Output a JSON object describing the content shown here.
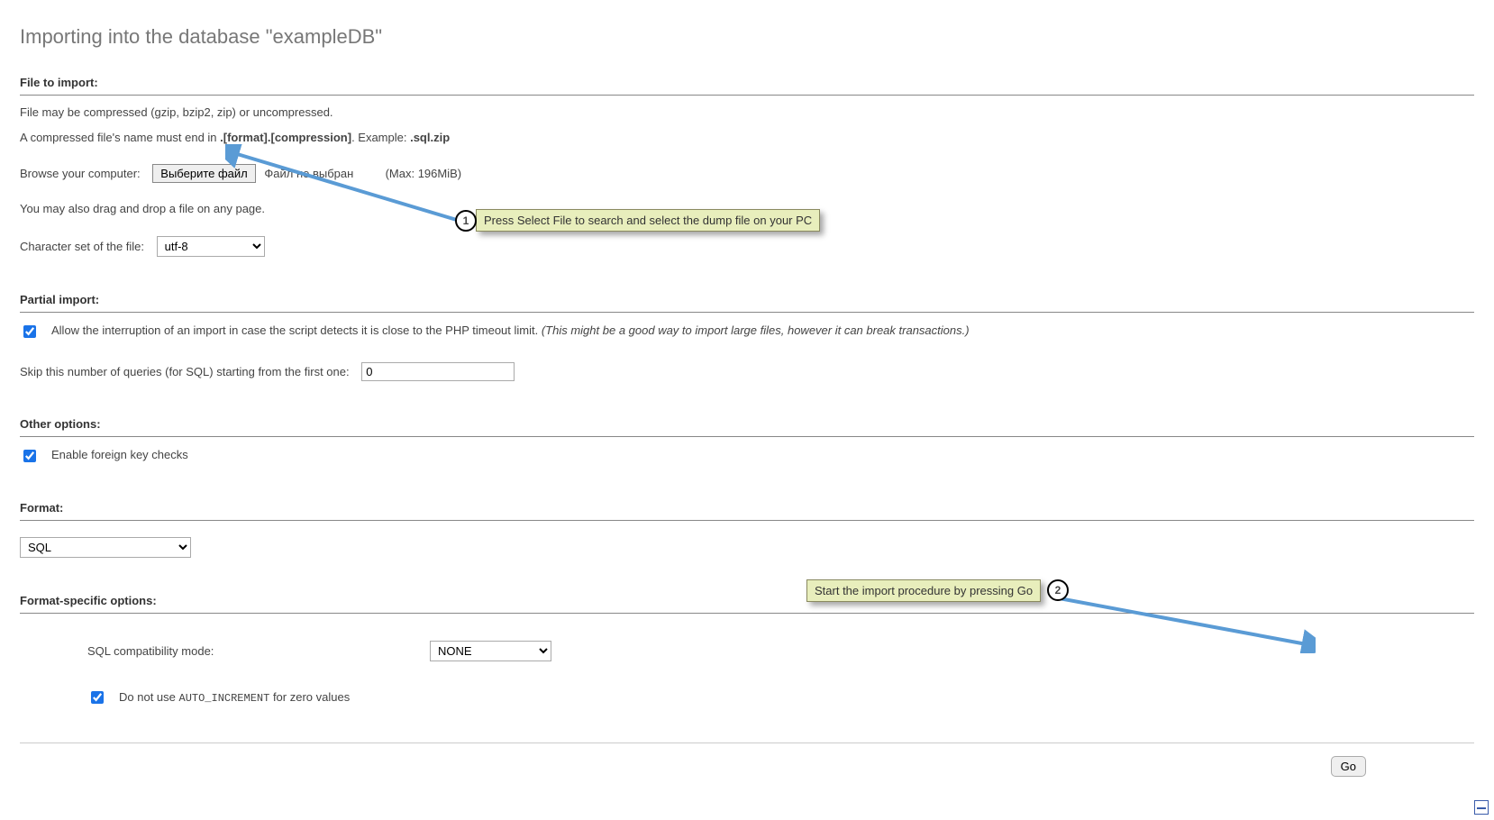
{
  "page_title": "Importing into the database \"exampleDB\"",
  "file_to_import": {
    "heading": "File to import:",
    "compressed_note": "File may be compressed (gzip, bzip2, zip) or uncompressed.",
    "name_note_prefix": "A compressed file's name must end in ",
    "name_note_pattern": ".[format].[compression]",
    "name_note_example_label": ". Example: ",
    "name_note_example": ".sql.zip",
    "browse_label": "Browse your computer:",
    "browse_button": "Выберите файл",
    "no_file_selected": "Файл не выбран",
    "max_label": "(Max: 196MiB)",
    "drag_note": "You may also drag and drop a file on any page.",
    "charset_label": "Character set of the file:",
    "charset_value": "utf-8"
  },
  "partial_import": {
    "heading": "Partial import:",
    "allow_interrupt_checked": true,
    "allow_interrupt_text": "Allow the interruption of an import in case the script detects it is close to the PHP timeout limit. ",
    "allow_interrupt_note": "(This might be a good way to import large files, however it can break transactions.)",
    "skip_label": "Skip this number of queries (for SQL) starting from the first one:",
    "skip_value": "0"
  },
  "other_options": {
    "heading": "Other options:",
    "fk_checked": true,
    "fk_label": "Enable foreign key checks"
  },
  "format": {
    "heading": "Format:",
    "value": "SQL"
  },
  "format_specific": {
    "heading": "Format-specific options:",
    "compat_label": "SQL compatibility mode:",
    "compat_value": "NONE",
    "no_ai_checked": true,
    "no_ai_prefix": "Do not use ",
    "no_ai_code": "AUTO_INCREMENT",
    "no_ai_suffix": " for zero values"
  },
  "go_button": "Go",
  "annotations": {
    "step1_text": "Press Select File to search and select the dump file on your PC",
    "step1_num": "1",
    "step2_text": "Start the import procedure by pressing Go",
    "step2_num": "2"
  }
}
